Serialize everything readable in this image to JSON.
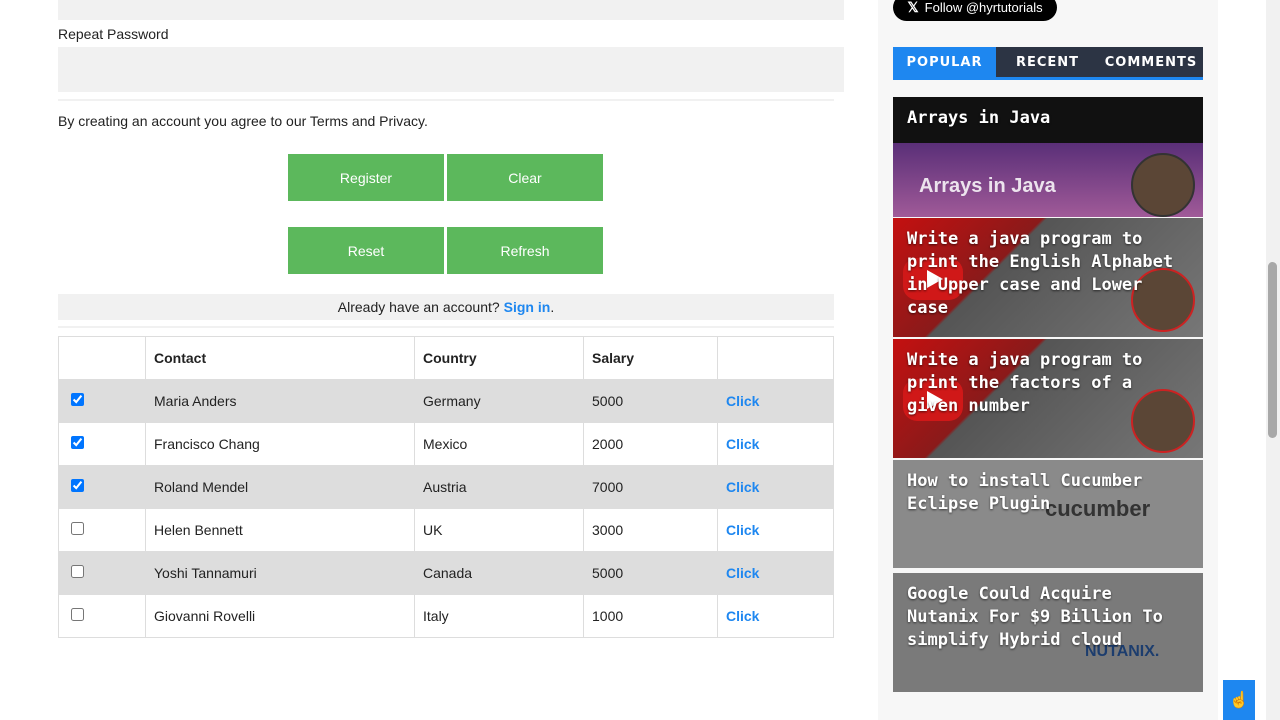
{
  "form": {
    "repeat_password_label": "Repeat Password",
    "repeat_password_value": "",
    "agree_text": "By creating an account you agree to our Terms and Privacy.",
    "buttons": {
      "register": "Register",
      "clear": "Clear",
      "reset": "Reset",
      "refresh": "Refresh"
    },
    "signin_prompt": "Already have an account?",
    "signin_link": "Sign in",
    "signin_suffix": "."
  },
  "table": {
    "headers": [
      "",
      "Contact",
      "Country",
      "Salary",
      ""
    ],
    "rows": [
      {
        "checked": true,
        "contact": "Maria Anders",
        "country": "Germany",
        "salary": "5000",
        "action": "Click"
      },
      {
        "checked": true,
        "contact": "Francisco Chang",
        "country": "Mexico",
        "salary": "2000",
        "action": "Click"
      },
      {
        "checked": true,
        "contact": "Roland Mendel",
        "country": "Austria",
        "salary": "7000",
        "action": "Click"
      },
      {
        "checked": false,
        "contact": "Helen Bennett",
        "country": "UK",
        "salary": "3000",
        "action": "Click"
      },
      {
        "checked": false,
        "contact": "Yoshi Tannamuri",
        "country": "Canada",
        "salary": "5000",
        "action": "Click"
      },
      {
        "checked": false,
        "contact": "Giovanni Rovelli",
        "country": "Italy",
        "salary": "1000",
        "action": "Click"
      }
    ]
  },
  "sidebar": {
    "follow_button": "Follow @hyrtutorials",
    "tabs": [
      "POPULAR",
      "RECENT",
      "COMMENTS"
    ],
    "posts": [
      {
        "title": "Arrays in Java",
        "thumb_text": "Arrays in Java"
      },
      {
        "title": "Write a java program to print the English Alphabet in Upper case and Lower case"
      },
      {
        "title": "Write a java program to print the factors of a given number"
      },
      {
        "title": "How to install Cucumber Eclipse Plugin",
        "thumb_text": "cucumber"
      },
      {
        "title": "Google Could Acquire Nutanix For $9 Billion To simplify Hybrid cloud",
        "thumb_text": "NUTANIX."
      }
    ]
  },
  "colors": {
    "button_green": "#5cb85c",
    "link_blue": "#1e87f0",
    "tab_bg": "#2c3444",
    "row_alt": "#dddddd"
  }
}
